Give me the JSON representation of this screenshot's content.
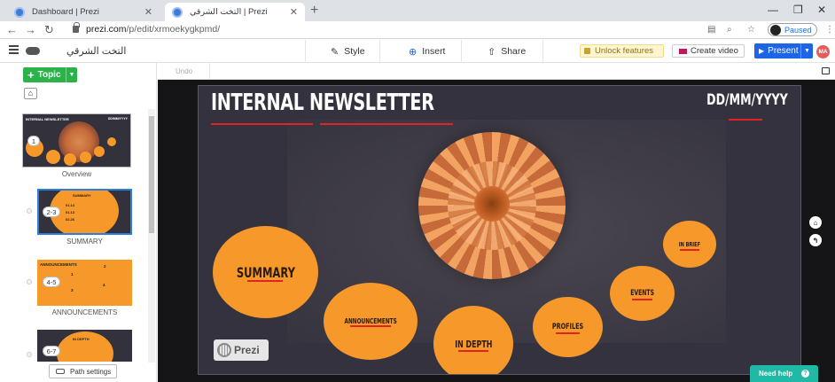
{
  "browser": {
    "tabs": [
      {
        "title": "Dashboard | Prezi",
        "active": false
      },
      {
        "title": "التخت الشرقي | Prezi",
        "active": true
      }
    ],
    "url_host": "prezi.com",
    "url_path": "/p/edit/xrmoekygkpmd/",
    "profile_status": "Paused",
    "icons": {
      "back": "back-arrow-icon",
      "forward": "forward-arrow-icon",
      "reload": "reload-icon",
      "lock": "lock-icon"
    }
  },
  "toolbar": {
    "presentation_title": "التخت الشرقي",
    "style_label": "Style",
    "insert_label": "Insert",
    "share_label": "Share",
    "unlock_label": "Unlock features",
    "create_video_label": "Create video",
    "present_label": "Present",
    "avatar_initials": "MA",
    "brand_colors": {
      "present": "#1e64e6",
      "topic": "#2bb34a",
      "help": "#1fb9a5"
    }
  },
  "left_panel": {
    "topic_label": "Topic",
    "path_settings_label": "Path settings",
    "slides": [
      {
        "badge": "1",
        "label": "Overview",
        "title": "INTERNAL NEWSLETTER",
        "date": "DD/MM/YYYY"
      },
      {
        "badge": "2-3",
        "label": "SUMMARY",
        "title": "SUMMARY",
        "lines": [
          "01.14",
          "01.13",
          "02.26"
        ]
      },
      {
        "badge": "4-5",
        "label": "ANNOUNCEMENTS",
        "title": "ANNOUNCEMENTS",
        "marks": [
          "1",
          "2",
          "3",
          "4"
        ]
      },
      {
        "badge": "6-7",
        "label": "",
        "title": "IN DEPTH"
      }
    ]
  },
  "undo_label": "Undo",
  "slide": {
    "title": "INTERNAL NEWSLETTER",
    "date": "DD/MM/YYYY",
    "accent_color": "#f7982a",
    "underline_color": "#e02424",
    "topics": [
      {
        "label": "SUMMARY"
      },
      {
        "label": "ANNOUNCEMENTS"
      },
      {
        "label": "IN DEPTH"
      },
      {
        "label": "PROFILES"
      },
      {
        "label": "EVENTS"
      },
      {
        "label": "IN BRIEF"
      }
    ],
    "logo_text": "Prezi"
  },
  "help_label": "Need help"
}
